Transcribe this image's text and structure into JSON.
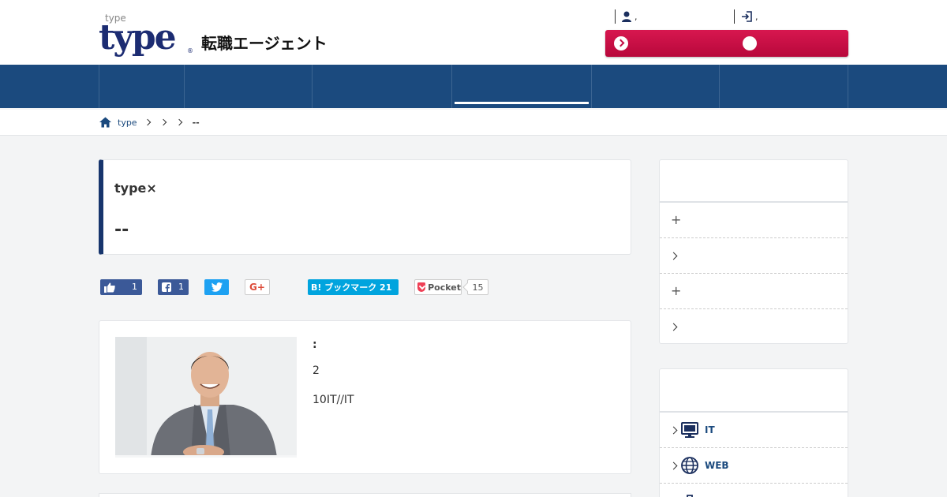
{
  "header": {
    "site_tag": "type",
    "logo_word": "type",
    "logo_registered": "®",
    "logo_sub": "転職エージェント",
    "user_link": ",",
    "login_link": ","
  },
  "breadcrumb": {
    "home": "type",
    "current": "--"
  },
  "article": {
    "kicker": "type×",
    "title": "--"
  },
  "share": {
    "like_count": "1",
    "facebook_count": "1",
    "googleplus": "G+",
    "hatena": "B! ブックマーク 21",
    "pocket": "Pocket",
    "pocket_count": "15"
  },
  "profile": {
    "colon": ":",
    "line1": "2",
    "line2": "10IT//IT"
  },
  "sidebar": {
    "menu": [
      {
        "icon": "plus-icon",
        "symbol": "+"
      },
      {
        "icon": "chevron-right-icon"
      },
      {
        "icon": "plus-icon",
        "symbol": "+"
      },
      {
        "icon": "chevron-right-icon"
      }
    ],
    "categories": [
      {
        "icon": "monitor-icon",
        "label": "IT"
      },
      {
        "icon": "globe-icon",
        "label": "WEB"
      }
    ]
  },
  "colors": {
    "nav": "#1b4a7e",
    "cta": "#c70d44",
    "accent_border": "#17356d"
  }
}
